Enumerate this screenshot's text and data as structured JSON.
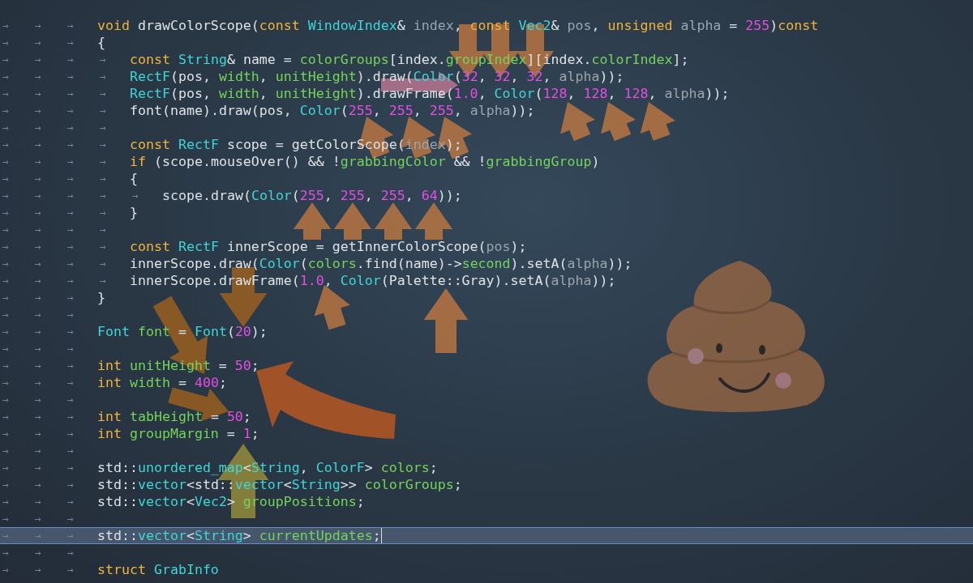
{
  "editor": {
    "lines": [
      {
        "tabs": [
          "→",
          "→",
          "→"
        ],
        "current": false,
        "tokens": [
          {
            "text": "void",
            "kind": "kw"
          },
          {
            "text": " drawColorScope(",
            "kind": "plain"
          },
          {
            "text": "const ",
            "kind": "kw"
          },
          {
            "text": "WindowIndex",
            "kind": "type"
          },
          {
            "text": "& ",
            "kind": "plain"
          },
          {
            "text": "index",
            "kind": "param"
          },
          {
            "text": ", ",
            "kind": "plain"
          },
          {
            "text": "const ",
            "kind": "kw"
          },
          {
            "text": "Vec2",
            "kind": "type"
          },
          {
            "text": "& ",
            "kind": "plain"
          },
          {
            "text": "pos",
            "kind": "param"
          },
          {
            "text": ", ",
            "kind": "plain"
          },
          {
            "text": "unsigned ",
            "kind": "kw"
          },
          {
            "text": "alpha",
            "kind": "param"
          },
          {
            "text": " = ",
            "kind": "plain"
          },
          {
            "text": "255",
            "kind": "num"
          },
          {
            "text": ")",
            "kind": "plain"
          },
          {
            "text": "const",
            "kind": "kw"
          }
        ]
      },
      {
        "tabs": [
          "→",
          "→",
          "→"
        ],
        "current": false,
        "tokens": [
          {
            "text": "{",
            "kind": "plain"
          }
        ]
      },
      {
        "tabs": [
          "→",
          "→",
          "→",
          "→"
        ],
        "current": false,
        "tokens": [
          {
            "text": "const ",
            "kind": "kw"
          },
          {
            "text": "String",
            "kind": "type"
          },
          {
            "text": "& name = ",
            "kind": "plain"
          },
          {
            "text": "colorGroups",
            "kind": "var"
          },
          {
            "text": "[index.",
            "kind": "plain"
          },
          {
            "text": "groupIndex",
            "kind": "var"
          },
          {
            "text": "][index.",
            "kind": "plain"
          },
          {
            "text": "colorIndex",
            "kind": "var"
          },
          {
            "text": "];",
            "kind": "plain"
          }
        ]
      },
      {
        "tabs": [
          "→",
          "→",
          "→",
          "→"
        ],
        "current": false,
        "tokens": [
          {
            "text": "RectF",
            "kind": "type"
          },
          {
            "text": "(pos, ",
            "kind": "plain"
          },
          {
            "text": "width",
            "kind": "var"
          },
          {
            "text": ", ",
            "kind": "plain"
          },
          {
            "text": "unitHeight",
            "kind": "var"
          },
          {
            "text": ").draw(",
            "kind": "plain"
          },
          {
            "text": "Color",
            "kind": "type"
          },
          {
            "text": "(",
            "kind": "plain"
          },
          {
            "text": "32",
            "kind": "num"
          },
          {
            "text": ", ",
            "kind": "plain"
          },
          {
            "text": "32",
            "kind": "num"
          },
          {
            "text": ", ",
            "kind": "plain"
          },
          {
            "text": "32",
            "kind": "num"
          },
          {
            "text": ", ",
            "kind": "plain"
          },
          {
            "text": "alpha",
            "kind": "param"
          },
          {
            "text": "));",
            "kind": "plain"
          }
        ]
      },
      {
        "tabs": [
          "→",
          "→",
          "→",
          "→"
        ],
        "current": false,
        "tokens": [
          {
            "text": "RectF",
            "kind": "type"
          },
          {
            "text": "(pos, ",
            "kind": "plain"
          },
          {
            "text": "width",
            "kind": "var"
          },
          {
            "text": ", ",
            "kind": "plain"
          },
          {
            "text": "unitHeight",
            "kind": "var"
          },
          {
            "text": ").drawFrame(",
            "kind": "plain"
          },
          {
            "text": "1.0",
            "kind": "num"
          },
          {
            "text": ", ",
            "kind": "plain"
          },
          {
            "text": "Color",
            "kind": "type"
          },
          {
            "text": "(",
            "kind": "plain"
          },
          {
            "text": "128",
            "kind": "num"
          },
          {
            "text": ", ",
            "kind": "plain"
          },
          {
            "text": "128",
            "kind": "num"
          },
          {
            "text": ", ",
            "kind": "plain"
          },
          {
            "text": "128",
            "kind": "num"
          },
          {
            "text": ", ",
            "kind": "plain"
          },
          {
            "text": "alpha",
            "kind": "param"
          },
          {
            "text": "));",
            "kind": "plain"
          }
        ]
      },
      {
        "tabs": [
          "→",
          "→",
          "→",
          "→"
        ],
        "current": false,
        "tokens": [
          {
            "text": "font(name).draw(pos, ",
            "kind": "plain"
          },
          {
            "text": "Color",
            "kind": "type"
          },
          {
            "text": "(",
            "kind": "plain"
          },
          {
            "text": "255",
            "kind": "num"
          },
          {
            "text": ", ",
            "kind": "plain"
          },
          {
            "text": "255",
            "kind": "num"
          },
          {
            "text": ", ",
            "kind": "plain"
          },
          {
            "text": "255",
            "kind": "num"
          },
          {
            "text": ", ",
            "kind": "plain"
          },
          {
            "text": "alpha",
            "kind": "param"
          },
          {
            "text": "));",
            "kind": "plain"
          }
        ]
      },
      {
        "tabs": [
          "→",
          "→",
          "→",
          "→"
        ],
        "current": false
      },
      {
        "tabs": [
          "→",
          "→",
          "→",
          "→"
        ],
        "current": false,
        "tokens": [
          {
            "text": "const ",
            "kind": "kw"
          },
          {
            "text": "RectF",
            "kind": "type"
          },
          {
            "text": " scope = getColorScope(",
            "kind": "plain"
          },
          {
            "text": "index",
            "kind": "param"
          },
          {
            "text": ");",
            "kind": "plain"
          }
        ]
      },
      {
        "tabs": [
          "→",
          "→",
          "→",
          "→"
        ],
        "current": false,
        "tokens": [
          {
            "text": "if",
            "kind": "kw"
          },
          {
            "text": " (scope.mouseOver() && !",
            "kind": "plain"
          },
          {
            "text": "grabbingColor",
            "kind": "var"
          },
          {
            "text": " && !",
            "kind": "plain"
          },
          {
            "text": "grabbingGroup",
            "kind": "var"
          },
          {
            "text": ")",
            "kind": "plain"
          }
        ]
      },
      {
        "tabs": [
          "→",
          "→",
          "→",
          "→"
        ],
        "current": false,
        "tokens": [
          {
            "text": "{",
            "kind": "plain"
          }
        ]
      },
      {
        "tabs": [
          "→",
          "→",
          "→",
          "→",
          "→"
        ],
        "current": false,
        "tokens": [
          {
            "text": "scope.draw(",
            "kind": "plain"
          },
          {
            "text": "Color",
            "kind": "type"
          },
          {
            "text": "(",
            "kind": "plain"
          },
          {
            "text": "255",
            "kind": "num"
          },
          {
            "text": ", ",
            "kind": "plain"
          },
          {
            "text": "255",
            "kind": "num"
          },
          {
            "text": ", ",
            "kind": "plain"
          },
          {
            "text": "255",
            "kind": "num"
          },
          {
            "text": ", ",
            "kind": "plain"
          },
          {
            "text": "64",
            "kind": "num"
          },
          {
            "text": "));",
            "kind": "plain"
          }
        ]
      },
      {
        "tabs": [
          "→",
          "→",
          "→",
          "→"
        ],
        "current": false,
        "tokens": [
          {
            "text": "}",
            "kind": "plain"
          }
        ]
      },
      {
        "tabs": [
          "→",
          "→",
          "→",
          "→"
        ],
        "current": false
      },
      {
        "tabs": [
          "→",
          "→",
          "→",
          "→"
        ],
        "current": false,
        "tokens": [
          {
            "text": "const ",
            "kind": "kw"
          },
          {
            "text": "RectF",
            "kind": "type"
          },
          {
            "text": " innerScope = getInnerColorScope(",
            "kind": "plain"
          },
          {
            "text": "pos",
            "kind": "param"
          },
          {
            "text": ");",
            "kind": "plain"
          }
        ]
      },
      {
        "tabs": [
          "→",
          "→",
          "→",
          "→"
        ],
        "current": false,
        "tokens": [
          {
            "text": "innerScope.draw(",
            "kind": "plain"
          },
          {
            "text": "Color",
            "kind": "type"
          },
          {
            "text": "(",
            "kind": "plain"
          },
          {
            "text": "colors",
            "kind": "var"
          },
          {
            "text": ".find(name)->",
            "kind": "plain"
          },
          {
            "text": "second",
            "kind": "var"
          },
          {
            "text": ").setA(",
            "kind": "plain"
          },
          {
            "text": "alpha",
            "kind": "param"
          },
          {
            "text": "));",
            "kind": "plain"
          }
        ]
      },
      {
        "tabs": [
          "→",
          "→",
          "→",
          "→"
        ],
        "current": false,
        "tokens": [
          {
            "text": "innerScope.drawFrame(",
            "kind": "plain"
          },
          {
            "text": "1.0",
            "kind": "num"
          },
          {
            "text": ", ",
            "kind": "plain"
          },
          {
            "text": "Color",
            "kind": "type"
          },
          {
            "text": "(Palette::Gray).setA(",
            "kind": "plain"
          },
          {
            "text": "alpha",
            "kind": "param"
          },
          {
            "text": "));",
            "kind": "plain"
          }
        ]
      },
      {
        "tabs": [
          "→",
          "→",
          "→"
        ],
        "current": false,
        "tokens": [
          {
            "text": "}",
            "kind": "plain"
          }
        ]
      },
      {
        "tabs": [
          "→",
          "→",
          "→"
        ],
        "current": false
      },
      {
        "tabs": [
          "→",
          "→",
          "→"
        ],
        "current": false,
        "tokens": [
          {
            "text": "Font ",
            "kind": "type"
          },
          {
            "text": "font",
            "kind": "var"
          },
          {
            "text": " = ",
            "kind": "plain"
          },
          {
            "text": "Font",
            "kind": "type"
          },
          {
            "text": "(",
            "kind": "plain"
          },
          {
            "text": "20",
            "kind": "num"
          },
          {
            "text": ");",
            "kind": "plain"
          }
        ]
      },
      {
        "tabs": [
          "→",
          "→",
          "→"
        ],
        "current": false
      },
      {
        "tabs": [
          "→",
          "→",
          "→"
        ],
        "current": false,
        "tokens": [
          {
            "text": "int ",
            "kind": "kw"
          },
          {
            "text": "unitHeight",
            "kind": "var"
          },
          {
            "text": " = ",
            "kind": "plain"
          },
          {
            "text": "50",
            "kind": "num"
          },
          {
            "text": ";",
            "kind": "plain"
          }
        ]
      },
      {
        "tabs": [
          "→",
          "→",
          "→"
        ],
        "current": false,
        "tokens": [
          {
            "text": "int ",
            "kind": "kw"
          },
          {
            "text": "width",
            "kind": "var"
          },
          {
            "text": " = ",
            "kind": "plain"
          },
          {
            "text": "400",
            "kind": "num"
          },
          {
            "text": ";",
            "kind": "plain"
          }
        ]
      },
      {
        "tabs": [
          "→",
          "→",
          "→"
        ],
        "current": false
      },
      {
        "tabs": [
          "→",
          "→",
          "→"
        ],
        "current": false,
        "tokens": [
          {
            "text": "int ",
            "kind": "kw"
          },
          {
            "text": "tabHeight",
            "kind": "var"
          },
          {
            "text": " = ",
            "kind": "plain"
          },
          {
            "text": "50",
            "kind": "num"
          },
          {
            "text": ";",
            "kind": "plain"
          }
        ]
      },
      {
        "tabs": [
          "→",
          "→",
          "→"
        ],
        "current": false,
        "tokens": [
          {
            "text": "int ",
            "kind": "kw"
          },
          {
            "text": "groupMargin",
            "kind": "var"
          },
          {
            "text": " = ",
            "kind": "plain"
          },
          {
            "text": "1",
            "kind": "num"
          },
          {
            "text": ";",
            "kind": "plain"
          }
        ]
      },
      {
        "tabs": [
          "→",
          "→",
          "→"
        ],
        "current": false
      },
      {
        "tabs": [
          "→",
          "→",
          "→"
        ],
        "current": false,
        "tokens": [
          {
            "text": "std::",
            "kind": "plain"
          },
          {
            "text": "unordered_map",
            "kind": "type"
          },
          {
            "text": "<",
            "kind": "plain"
          },
          {
            "text": "String",
            "kind": "type"
          },
          {
            "text": ", ",
            "kind": "plain"
          },
          {
            "text": "ColorF",
            "kind": "type"
          },
          {
            "text": "> ",
            "kind": "plain"
          },
          {
            "text": "colors",
            "kind": "var"
          },
          {
            "text": ";",
            "kind": "plain"
          }
        ]
      },
      {
        "tabs": [
          "→",
          "→",
          "→"
        ],
        "current": false,
        "tokens": [
          {
            "text": "std::",
            "kind": "plain"
          },
          {
            "text": "vector",
            "kind": "type"
          },
          {
            "text": "<std::",
            "kind": "plain"
          },
          {
            "text": "vector",
            "kind": "type"
          },
          {
            "text": "<",
            "kind": "plain"
          },
          {
            "text": "String",
            "kind": "type"
          },
          {
            "text": ">> ",
            "kind": "plain"
          },
          {
            "text": "colorGroups",
            "kind": "var"
          },
          {
            "text": ";",
            "kind": "plain"
          }
        ]
      },
      {
        "tabs": [
          "→",
          "→",
          "→"
        ],
        "current": false,
        "tokens": [
          {
            "text": "std::",
            "kind": "plain"
          },
          {
            "text": "vector",
            "kind": "type"
          },
          {
            "text": "<",
            "kind": "plain"
          },
          {
            "text": "Vec2",
            "kind": "type"
          },
          {
            "text": "> ",
            "kind": "plain"
          },
          {
            "text": "groupPositions",
            "kind": "var"
          },
          {
            "text": ";",
            "kind": "plain"
          }
        ]
      },
      {
        "tabs": [
          "→",
          "→",
          "→"
        ],
        "current": false
      },
      {
        "tabs": [
          "→",
          "→",
          "→"
        ],
        "current": true,
        "tokens": [
          {
            "text": "std::",
            "kind": "plain"
          },
          {
            "text": "vector",
            "kind": "type"
          },
          {
            "text": "<",
            "kind": "plain"
          },
          {
            "text": "String",
            "kind": "type"
          },
          {
            "text": "> ",
            "kind": "plain"
          },
          {
            "text": "currentUpdates",
            "kind": "var"
          },
          {
            "text": ";",
            "kind": "plain"
          }
        ]
      },
      {
        "tabs": [
          "→",
          "→",
          "→"
        ],
        "current": false
      },
      {
        "tabs": [
          "→",
          "→",
          "→"
        ],
        "current": false,
        "tokens": [
          {
            "text": "struct ",
            "kind": "kw"
          },
          {
            "text": "GrabInfo",
            "kind": "type"
          }
        ]
      }
    ]
  }
}
